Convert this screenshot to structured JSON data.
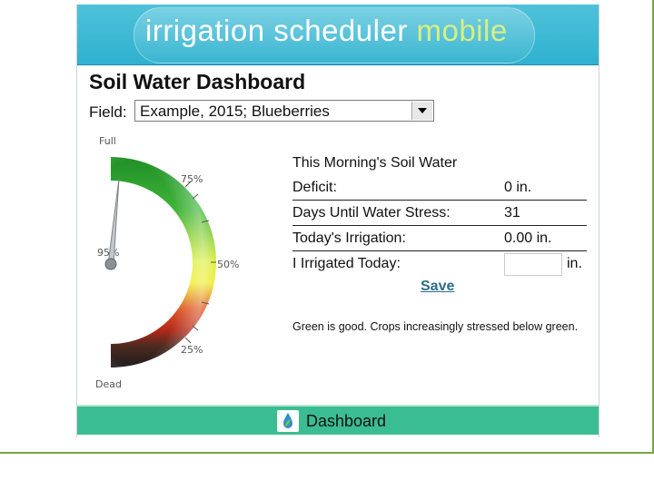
{
  "app": {
    "banner_title": "irrigation scheduler",
    "banner_suffix": "mobile"
  },
  "page": {
    "title": "Soil Water Dashboard",
    "field_label": "Field:",
    "field_value": "Example, 2015; Blueberries"
  },
  "gauge": {
    "top_label": "Full",
    "bottom_label": "Dead",
    "tick_75": "75%",
    "tick_50": "50%",
    "tick_25": "25%",
    "needle_readout": "95%",
    "needle_value_percent": 95
  },
  "soil_water": {
    "heading": "This Morning's Soil Water",
    "deficit_label": "Deficit:",
    "deficit_value": "0 in.",
    "days_label": "Days Until Water Stress:",
    "days_value": "31",
    "irrigation_label": "Today's Irrigation:",
    "irrigation_value": "0.00 in.",
    "irrigated_label": "I Irrigated Today:",
    "irrigated_input": "",
    "irrigated_unit": "in.",
    "save_label": "Save"
  },
  "note": "Green is good. Crops increasingly stressed below green.",
  "footer": {
    "label": "Dashboard",
    "icon": "water-drop-leaf-icon"
  },
  "colors": {
    "banner": "#36b4d1",
    "footer": "#3bbd93",
    "gauge_green": "#1e9a2f",
    "gauge_yellow": "#f0ee3a",
    "gauge_red": "#d22c1d",
    "gauge_dark": "#262323"
  }
}
